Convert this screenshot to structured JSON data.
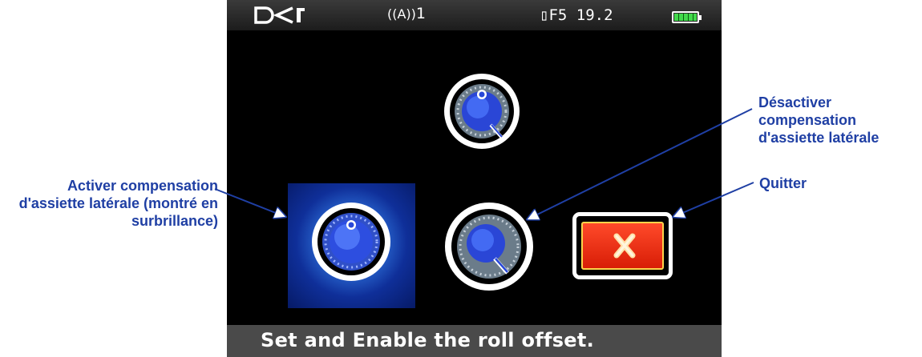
{
  "status_bar": {
    "logo": "DCI",
    "signal_channel": "1",
    "frequency": "F5 19.2",
    "battery_level": 1.0
  },
  "message": "Set and Enable the roll offset.",
  "buttons": {
    "enable": {
      "icon": "roll-offset-dial-icon",
      "highlighted": true
    },
    "set": {
      "icon": "roll-offset-dial-icon"
    },
    "disable": {
      "icon": "roll-offset-dial-icon"
    },
    "quit": {
      "icon": "close-x-icon"
    }
  },
  "callouts": {
    "enable": "Activer compensation d'assiette latérale (montré en surbrillance)",
    "disable": "Désactiver compensation d'assiette latérale",
    "quit": "Quitter"
  },
  "colors": {
    "callout_text": "#1f3fa4",
    "highlight_glow": "#2c6dd6",
    "exit_red": "#e8280d",
    "battery_green": "#41d94b"
  }
}
